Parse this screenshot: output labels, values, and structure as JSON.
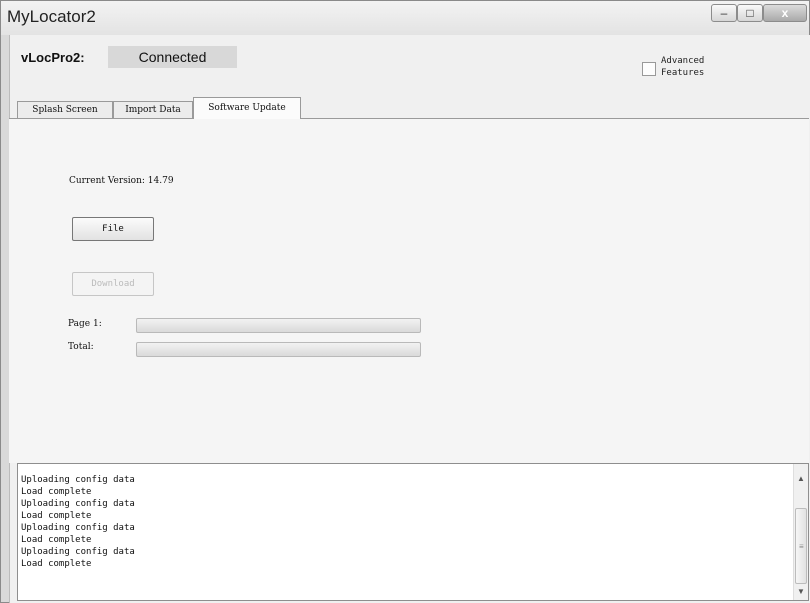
{
  "window": {
    "title": "MyLocator2",
    "controls": {
      "minimize": "–",
      "maximize": "□",
      "close": "x"
    }
  },
  "connection": {
    "device_label": "vLocPro2:",
    "status": "Connected"
  },
  "advanced": {
    "label": "Advanced Features",
    "checked": false
  },
  "tabs": [
    {
      "label": "Splash Screen",
      "active": false
    },
    {
      "label": "Import Data",
      "active": false
    },
    {
      "label": "Software Update",
      "active": true
    }
  ],
  "software_update": {
    "current_version_label": "Current Version: 14.79",
    "file_button": "File",
    "download_button": "Download",
    "download_enabled": false,
    "page_label": "Page 1:",
    "page_progress": 0,
    "total_label": "Total:",
    "total_progress": 0
  },
  "log": {
    "lines": [
      "Uploading config data",
      "Load complete",
      "Uploading config data",
      "Load complete",
      "Uploading config data",
      "Load complete",
      "Uploading config data",
      "Load complete"
    ],
    "scroll_up": "▲",
    "scroll_down": "▼",
    "grip": "≡"
  }
}
